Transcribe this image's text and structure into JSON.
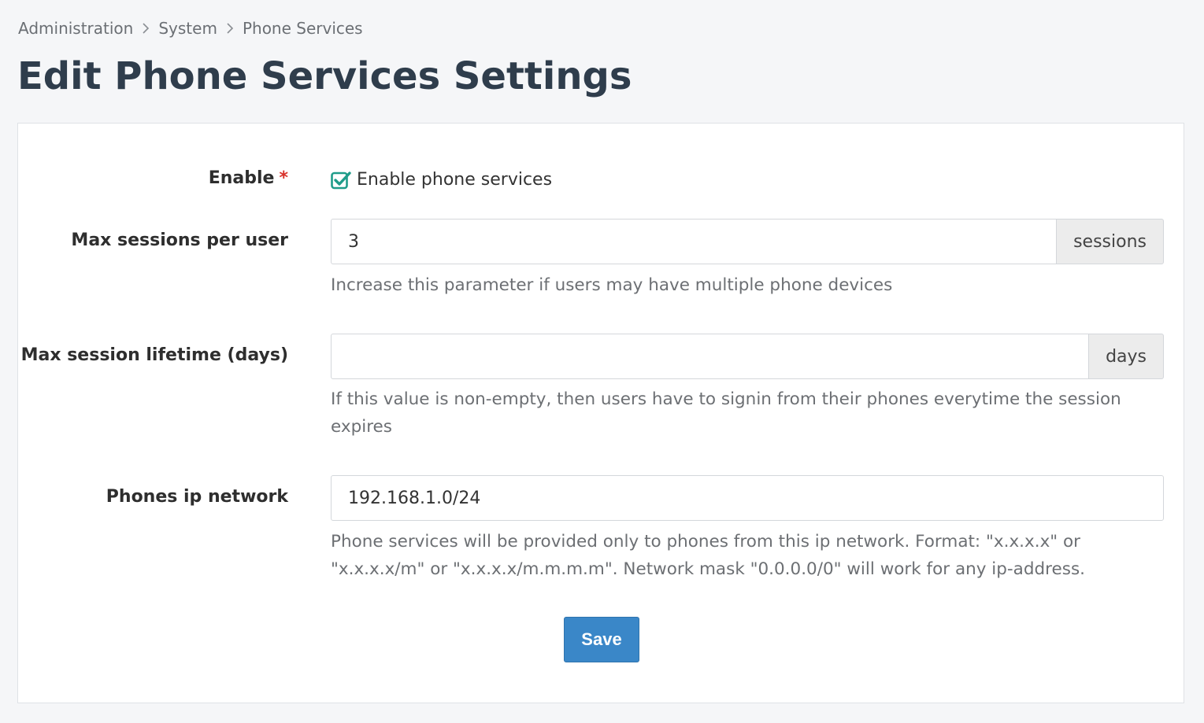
{
  "breadcrumb": {
    "items": [
      "Administration",
      "System",
      "Phone Services"
    ]
  },
  "page": {
    "title": "Edit Phone Services Settings"
  },
  "form": {
    "enable": {
      "label": "Enable",
      "required_mark": "*",
      "checkbox_label": "Enable phone services",
      "checked": true
    },
    "max_sessions": {
      "label": "Max sessions per user",
      "value": "3",
      "addon": "sessions",
      "help": "Increase this parameter if users may have multiple phone devices"
    },
    "max_lifetime": {
      "label": "Max session lifetime (days)",
      "value": "",
      "addon": "days",
      "help": "If this value is non-empty, then users have to signin from their phones everytime the session expires"
    },
    "ip_network": {
      "label": "Phones ip network",
      "value": "192.168.1.0/24",
      "help": "Phone services will be provided only to phones from this ip network. Format: \"x.x.x.x\" or \"x.x.x.x/m\" or \"x.x.x.x/m.m.m.m\". Network mask \"0.0.0.0/0\" will work for any ip-address."
    },
    "save_label": "Save"
  },
  "colors": {
    "checkbox_accent": "#1f9c8a",
    "primary_button": "#3a87c8",
    "required": "#d8322b"
  }
}
